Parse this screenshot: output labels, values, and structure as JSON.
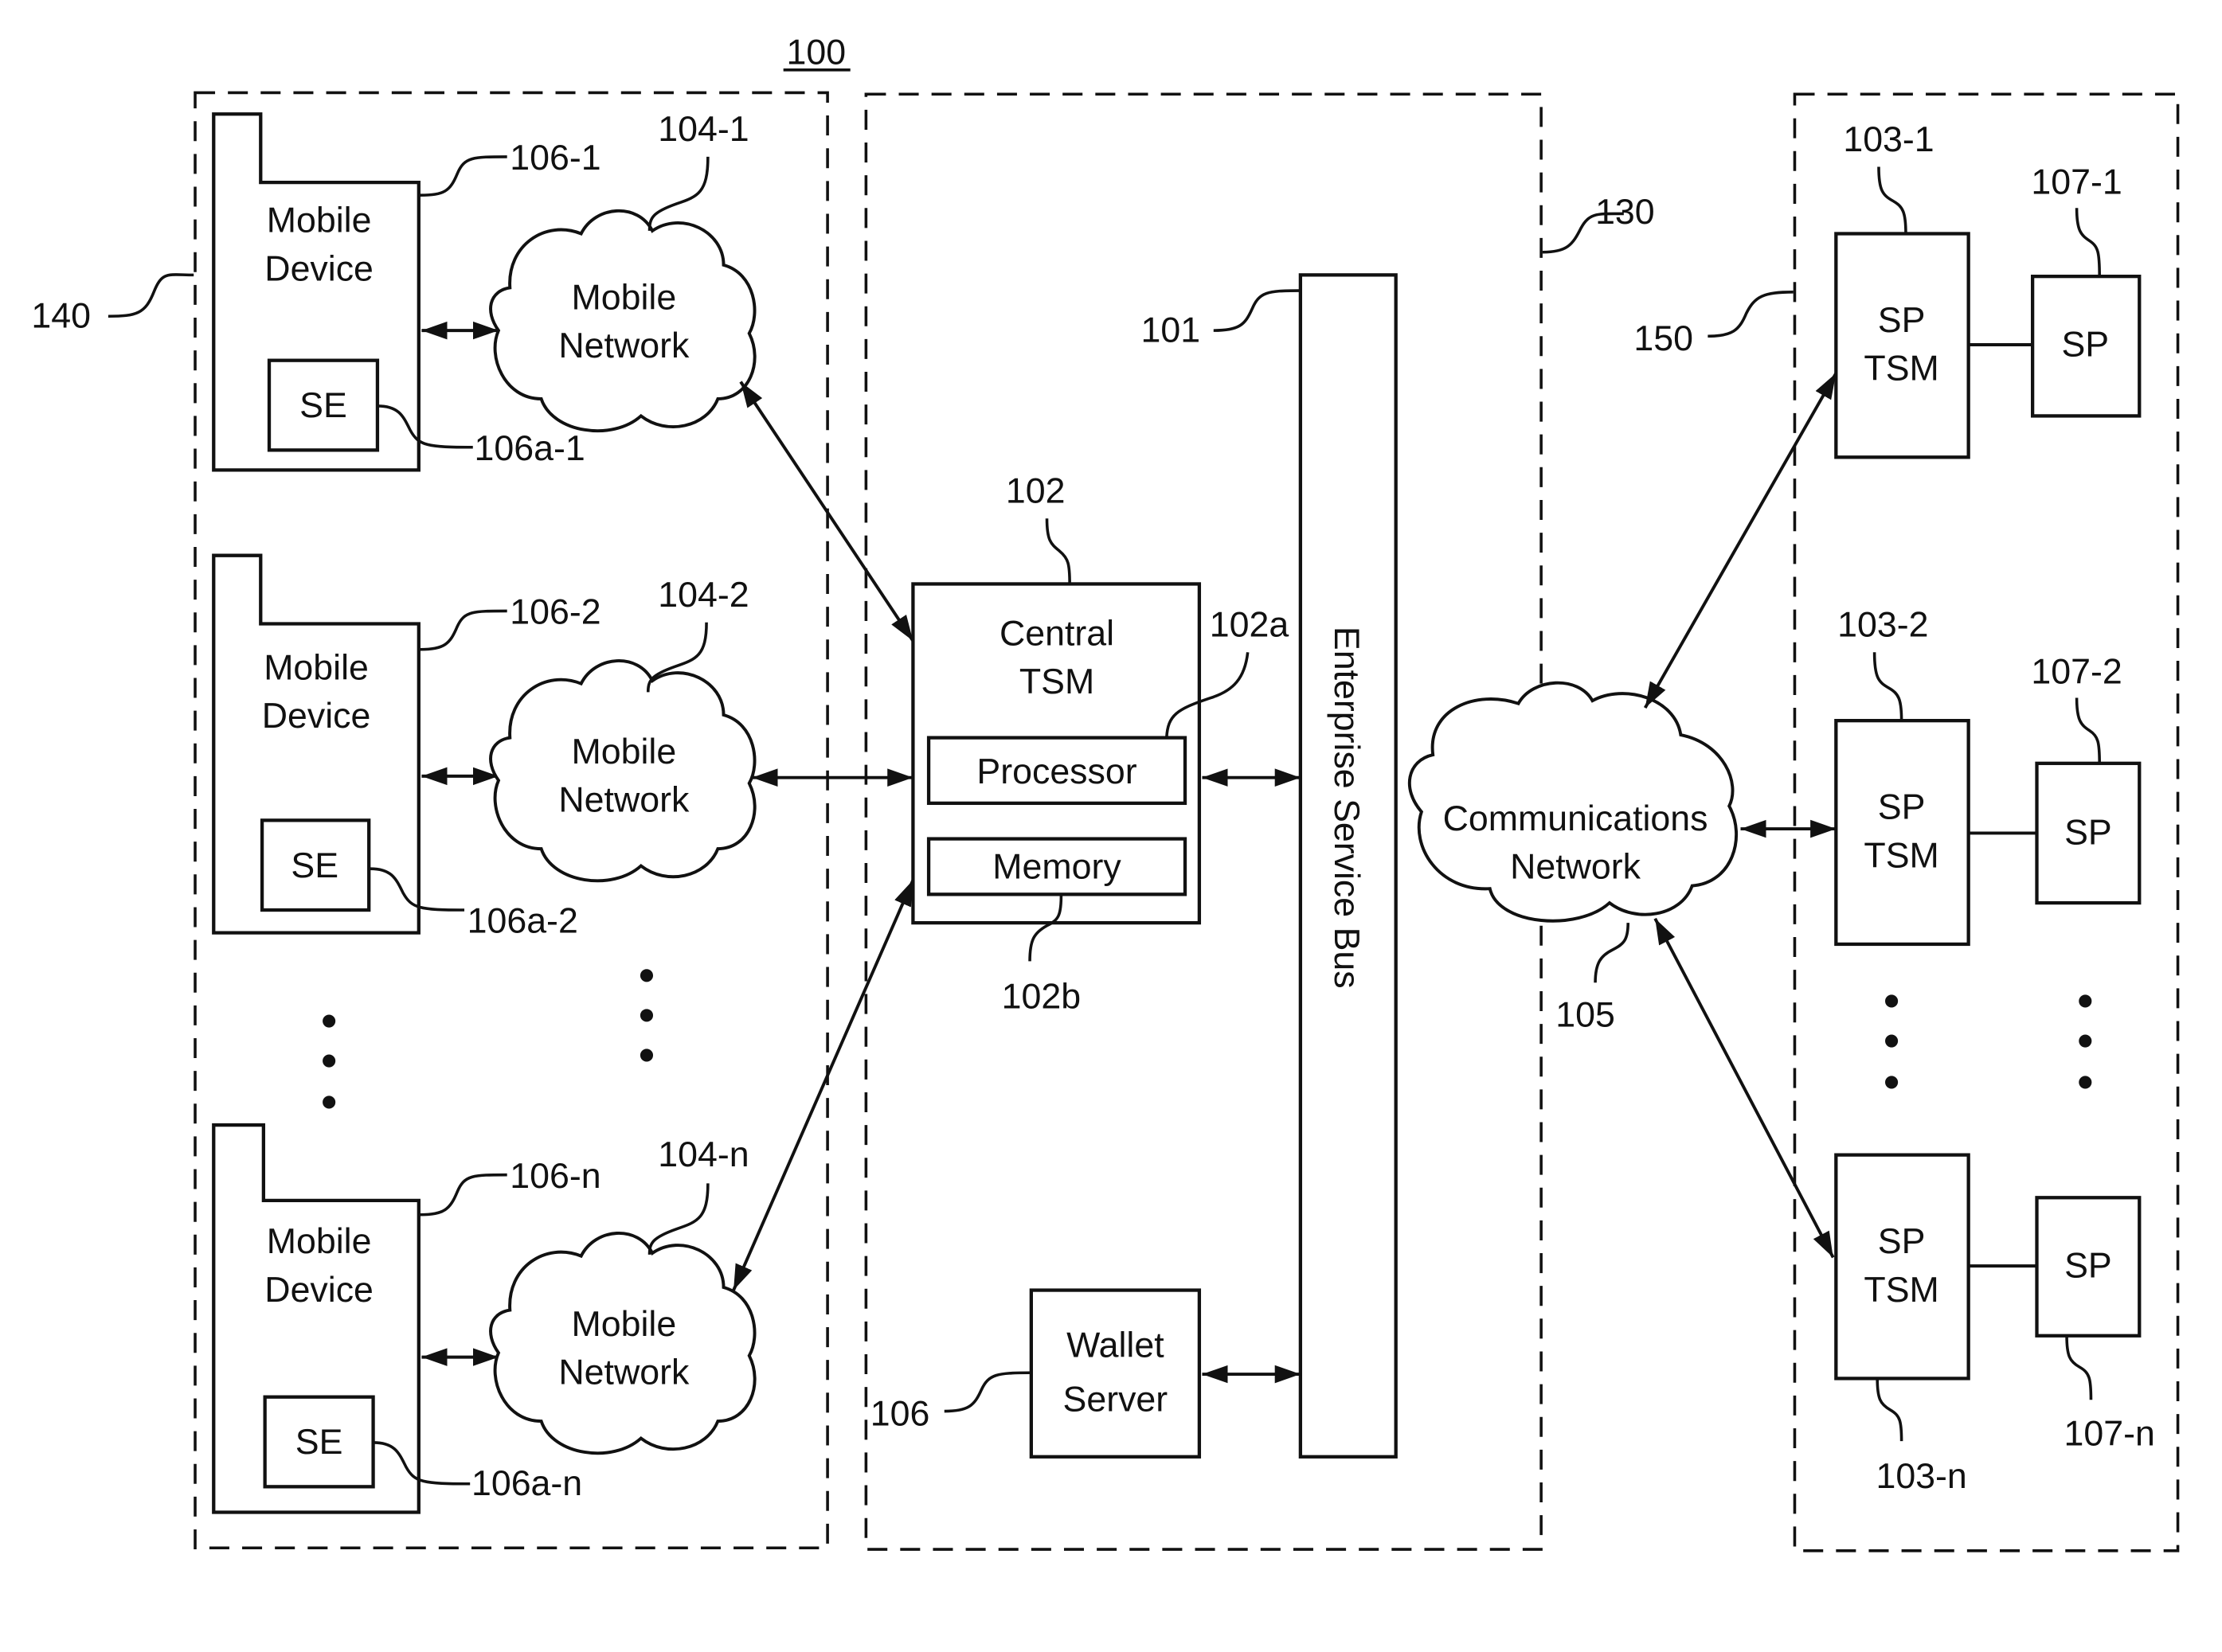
{
  "figure": {
    "number": "100",
    "colors": {
      "ink": "#111111",
      "background": "#ffffff"
    }
  },
  "groups": {
    "mobile_group_ref": "140",
    "central_group_ref": "130",
    "sp_group_ref": "150"
  },
  "mobile_devices": [
    {
      "label_line1": "Mobile",
      "label_line2": "Device",
      "ref": "106-1",
      "se_label": "SE",
      "se_ref": "106a-1",
      "network": {
        "label_line1": "Mobile",
        "label_line2": "Network",
        "ref": "104-1"
      }
    },
    {
      "label_line1": "Mobile",
      "label_line2": "Device",
      "ref": "106-2",
      "se_label": "SE",
      "se_ref": "106a-2",
      "network": {
        "label_line1": "Mobile",
        "label_line2": "Network",
        "ref": "104-2"
      }
    },
    {
      "label_line1": "Mobile",
      "label_line2": "Device",
      "ref": "106-n",
      "se_label": "SE",
      "se_ref": "106a-n",
      "network": {
        "label_line1": "Mobile",
        "label_line2": "Network",
        "ref": "104-n"
      }
    }
  ],
  "central_tsm": {
    "label_line1": "Central",
    "label_line2": "TSM",
    "ref": "102",
    "processor_label": "Processor",
    "processor_ref": "102a",
    "memory_label": "Memory",
    "memory_ref": "102b"
  },
  "esb": {
    "label": "Enterprise Service Bus",
    "ref": "101"
  },
  "wallet_server": {
    "label_line1": "Wallet",
    "label_line2": "Server",
    "ref": "106"
  },
  "comm_network": {
    "label_line1": "Communications",
    "label_line2": "Network",
    "ref": "105"
  },
  "service_providers": [
    {
      "tsm_line1": "SP",
      "tsm_line2": "TSM",
      "tsm_ref": "103-1",
      "sp_label": "SP",
      "sp_ref": "107-1"
    },
    {
      "tsm_line1": "SP",
      "tsm_line2": "TSM",
      "tsm_ref": "103-2",
      "sp_label": "SP",
      "sp_ref": "107-2"
    },
    {
      "tsm_line1": "SP",
      "tsm_line2": "TSM",
      "tsm_ref": "103-n",
      "sp_label": "SP",
      "sp_ref": "107-n"
    }
  ]
}
